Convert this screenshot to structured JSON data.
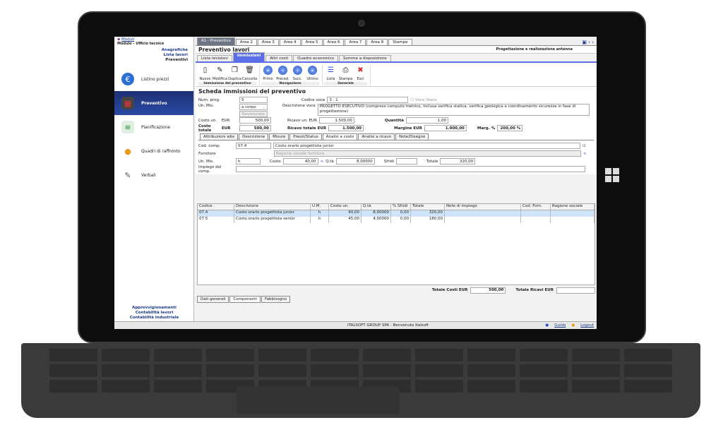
{
  "sidebar": {
    "moduli": "Moduli",
    "modulo": "Modulo - Ufficio tecnico",
    "links": [
      "Anagrafiche",
      "Lista lavori",
      "Preventivi"
    ],
    "items": [
      {
        "label": "Listino prezzi",
        "icon": "euro-icon"
      },
      {
        "label": "Preventivo",
        "icon": "calculator-icon"
      },
      {
        "label": "Pianificazione",
        "icon": "gantt-icon"
      },
      {
        "label": "Quadri di raffronto",
        "icon": "compare-icon"
      },
      {
        "label": "Verbali",
        "icon": "pen-icon"
      }
    ],
    "footer": [
      "Approvvigionamenti",
      "Contabilità lavori",
      "Contabilità industriale"
    ]
  },
  "top_tabs": [
    "A1 - Preventivo",
    "Area 2",
    "Area 3",
    "Area 4",
    "Area 5",
    "Area 6",
    "Area 7",
    "Area 8",
    "Stampe"
  ],
  "title": "Preventivo lavori",
  "project": "Progettazione e realizzazione antenna",
  "tabs2": [
    "Lista revisioni",
    "Immissioni",
    "Altri costi",
    "Quadro economico",
    "Somme a disposizione"
  ],
  "toolbar": {
    "group1": {
      "label": "Immissione del preventivo",
      "buttons": [
        "Nuovo",
        "Modifica",
        "Duplica",
        "Cancella"
      ]
    },
    "group2": {
      "label": "Navigazione",
      "buttons": [
        "Primo",
        "Preced.",
        "Succ.",
        "Ultimo"
      ]
    },
    "group3": {
      "label": "Generale",
      "buttons": [
        "Lista",
        "Stampa",
        "Esci"
      ]
    }
  },
  "sheet": {
    "heading": "Scheda immissioni del preventivo",
    "num_prog_label": "Num. prog.",
    "num_prog": "5",
    "codice_label": "Codice voce",
    "codice": "3 . 1",
    "voce_libera": "Voce libera",
    "um_label": "Un. Mis.",
    "um": "a corpo",
    "revisionata": "Revisionata",
    "descr_label": "Descrizione voce",
    "descr": "PROGETTO ESECUTIVO (compreso computo metrico, inclusa verifica statica, verifica geologica e coordinamento sicurezza in fase di progettazione)",
    "costo_un_label": "Costo un.",
    "eur": "EUR",
    "costo_un": "500,00",
    "ricavo_un_label": "Ricavo un. EUR",
    "ricavo_un": "1.500,00",
    "quantita_label": "Quantità",
    "quantita": "1,00",
    "costo_tot_label": "Costo totale",
    "costo_tot": "500,00",
    "ricavo_tot_label": "Ricavo totale EUR",
    "ricavo_tot": "1.500,00",
    "margine_label": "Margine EUR",
    "margine": "1.000,00",
    "marg_pct_label": "Marg. %",
    "marg_pct": "200,00 %"
  },
  "subtabs": [
    "Attribuzioni wbs",
    "Descrizione",
    "Misure",
    "Prezzi/Status",
    "Analisi a costo",
    "Analisi a ricavo",
    "Note/Disegno"
  ],
  "comp": {
    "cod_label": "Cod. comp.",
    "cod": "07.4",
    "cod_desc": "Costo orario progettista junior",
    "forn_label": "Fornitore",
    "forn_ph": "Ragione sociale fornitore",
    "um_label": "Un. Mis.",
    "um": "h",
    "costo_label": "Costo",
    "costo": "40,00",
    "qta_label": "Q.tà",
    "qta": "8,00000",
    "sfridi_label": "Sfridi",
    "totale_label": "Totale",
    "totale": "320,00",
    "impiego_label": "Impiego del comp."
  },
  "grid": {
    "headers": [
      "Codice",
      "Descrizione",
      "U.M.",
      "Costo un.",
      "Q.tà",
      "% Sfridi",
      "Totale",
      "Note di impiego",
      "Cod. Forn.",
      "Ragione sociale"
    ],
    "rows": [
      [
        "07.4",
        "Costo orario progettista junior",
        "h",
        "40,00",
        "8,00000",
        "0,00",
        "320,00",
        "",
        "",
        ""
      ],
      [
        "07.5",
        "Costo orario progettista senior",
        "h",
        "45,00",
        "4,00000",
        "0,00",
        "180,00",
        "",
        "",
        ""
      ]
    ]
  },
  "totals": {
    "costi_label": "Totale Costi EUR",
    "costi": "500,00",
    "ricavi_label": "Totale Ricavi EUR",
    "ricavi": ""
  },
  "bottom_tabs": [
    "Dati generali",
    "Componenti",
    "Fabbisogno"
  ],
  "status": {
    "msg": "ITALSOFT GROUP SPA - Benvenuto Italsoft",
    "guida": "Guida",
    "logout": "Logout"
  }
}
